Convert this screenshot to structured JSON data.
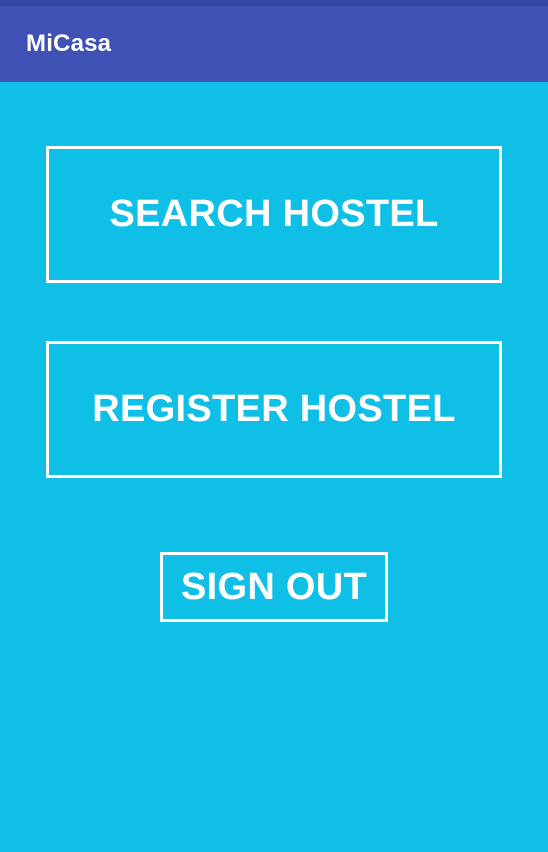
{
  "app_bar": {
    "title": "MiCasa"
  },
  "actions": {
    "search_label": "SEARCH HOSTEL",
    "register_label": "REGISTER HOSTEL",
    "signout_label": "SIGN OUT"
  },
  "colors": {
    "status_bar": "#3647a4",
    "app_bar": "#3f51b5",
    "background": "#0fbfe6",
    "button_border": "#ffffff",
    "text": "#ffffff"
  }
}
